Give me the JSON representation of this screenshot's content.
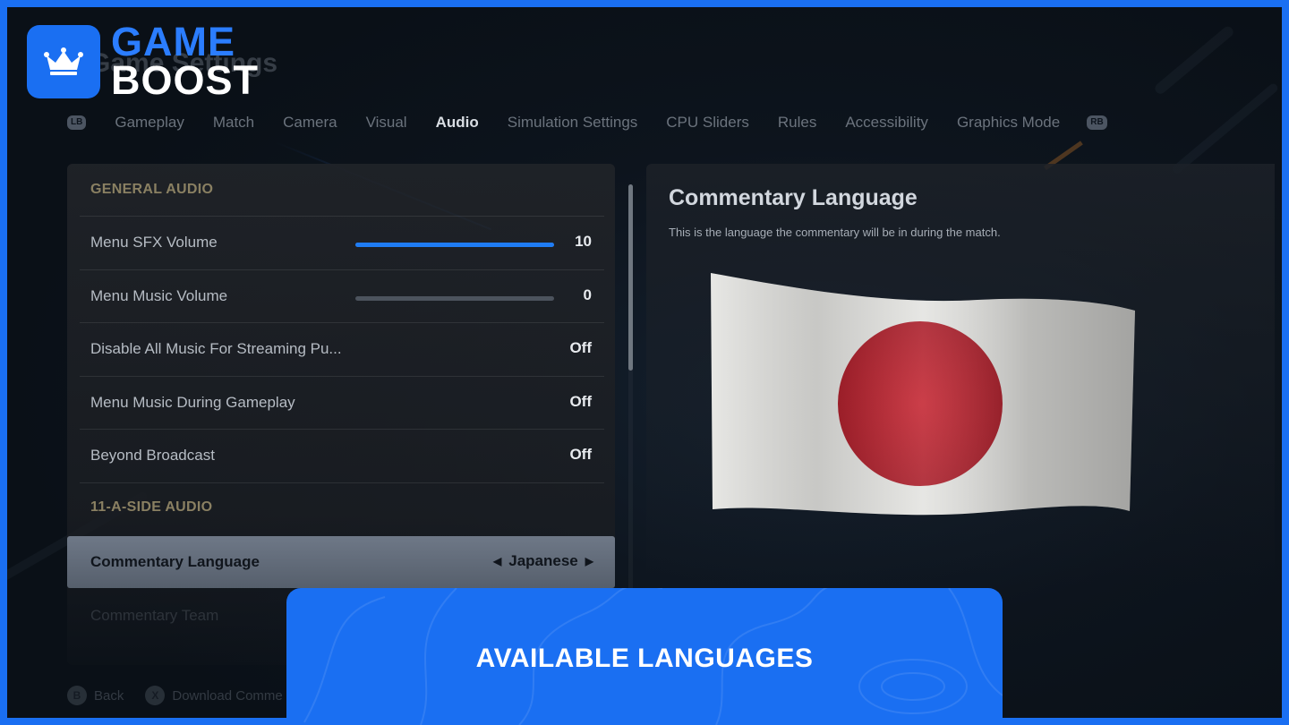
{
  "logo": {
    "line1": "GAME",
    "line2": "BOOST",
    "icon": "crown-icon"
  },
  "page": {
    "title": "Game Settings"
  },
  "tabs": {
    "left_bumper": "LB",
    "right_bumper": "RB",
    "items": [
      {
        "label": "Gameplay",
        "active": false
      },
      {
        "label": "Match",
        "active": false
      },
      {
        "label": "Camera",
        "active": false
      },
      {
        "label": "Visual",
        "active": false
      },
      {
        "label": "Audio",
        "active": true
      },
      {
        "label": "Simulation Settings",
        "active": false
      },
      {
        "label": "CPU Sliders",
        "active": false
      },
      {
        "label": "Rules",
        "active": false
      },
      {
        "label": "Accessibility",
        "active": false
      },
      {
        "label": "Graphics Mode",
        "active": false
      }
    ]
  },
  "settings": {
    "general_header": "GENERAL AUDIO",
    "eleven_header": "11-A-SIDE AUDIO",
    "rows": [
      {
        "label": "Menu SFX Volume",
        "value": "10",
        "level": 1.0
      },
      {
        "label": "Menu Music Volume",
        "value": "0",
        "level": 0.0
      },
      {
        "label": "Disable All Music For Streaming Pu...",
        "value": "Off"
      },
      {
        "label": "Menu Music During Gameplay",
        "value": "Off"
      },
      {
        "label": "Beyond Broadcast",
        "value": "Off"
      },
      {
        "label": "Commentary Language",
        "value": "Japanese"
      },
      {
        "label": "Commentary Team",
        "value": ""
      }
    ]
  },
  "info": {
    "title": "Commentary Language",
    "description": "This is the language the commentary will be in during the match.",
    "image": "japan-flag",
    "colors": {
      "flag_red": "#b5202c",
      "flag_white": "#e6e6e4"
    }
  },
  "hints": [
    {
      "button": "B",
      "label": "Back"
    },
    {
      "button": "X",
      "label": "Download Comme"
    }
  ],
  "banner": {
    "text": "AVAILABLE LANGUAGES",
    "color": "#1a6ff2"
  }
}
